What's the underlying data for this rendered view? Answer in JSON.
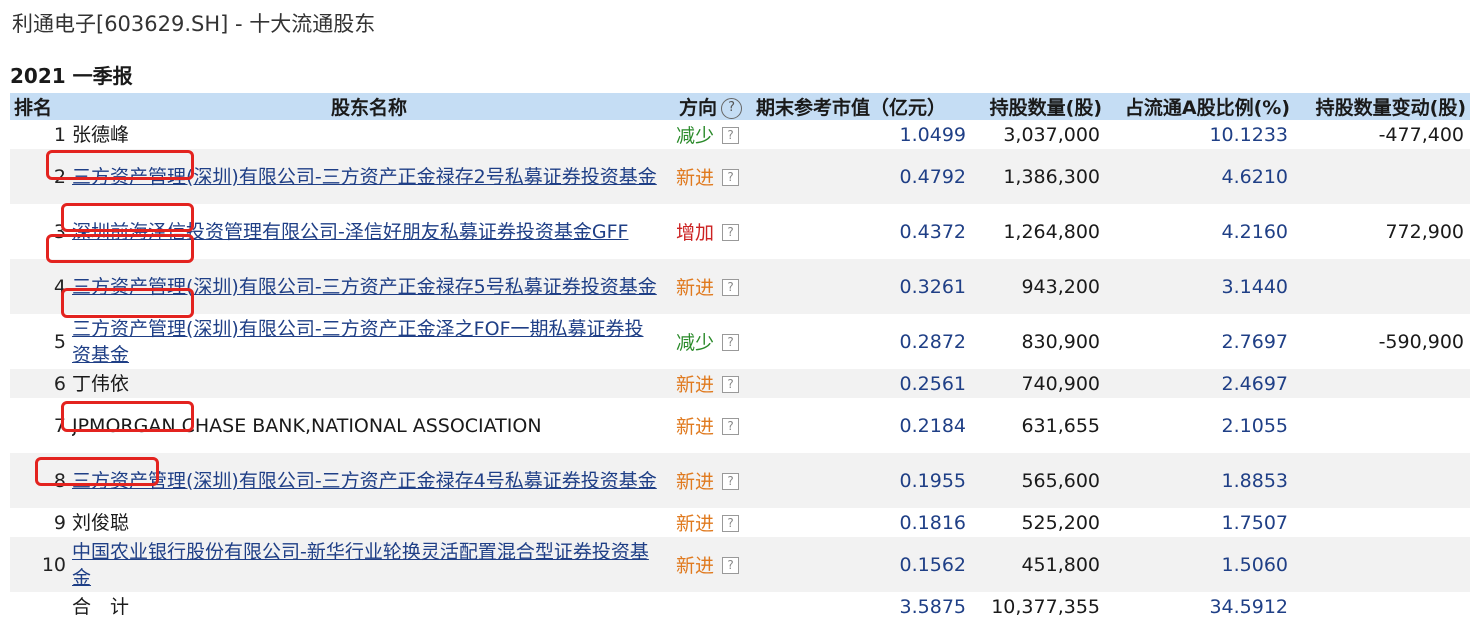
{
  "page": {
    "title": "利通电子[603629.SH] - 十大流通股东"
  },
  "report": {
    "period": "2021 一季报"
  },
  "table": {
    "headers": {
      "rank": "排名",
      "name": "股东名称",
      "direction": "方向",
      "help": "?",
      "market_value": "期末参考市值（亿元）",
      "shares": "持股数量(股)",
      "ratio": "占流通A股比例(%)",
      "change": "持股数量变动(股)"
    },
    "rows": [
      {
        "rank": "1",
        "name": "张德峰",
        "link": false,
        "direction": "减少",
        "dir_type": "down",
        "q": "?",
        "market_value": "1.0499",
        "shares": "3,037,000",
        "ratio": "10.1233",
        "change": "-477,400"
      },
      {
        "rank": "2",
        "name": "三方资产管理(深圳)有限公司-三方资产正金禄存2号私募证券投资基金",
        "link": true,
        "direction": "新进",
        "dir_type": "new",
        "q": "?",
        "market_value": "0.4792",
        "shares": "1,386,300",
        "ratio": "4.6210",
        "change": ""
      },
      {
        "rank": "3",
        "name": "深圳前海泽信投资管理有限公司-泽信好朋友私募证券投资基金GFF",
        "link": true,
        "direction": "增加",
        "dir_type": "up",
        "q": "?",
        "market_value": "0.4372",
        "shares": "1,264,800",
        "ratio": "4.2160",
        "change": "772,900"
      },
      {
        "rank": "4",
        "name": "三方资产管理(深圳)有限公司-三方资产正金禄存5号私募证券投资基金",
        "link": true,
        "direction": "新进",
        "dir_type": "new",
        "q": "?",
        "market_value": "0.3261",
        "shares": "943,200",
        "ratio": "3.1440",
        "change": ""
      },
      {
        "rank": "5",
        "name": "三方资产管理(深圳)有限公司-三方资产正金泽之FOF一期私募证券投资基金",
        "link": true,
        "direction": "减少",
        "dir_type": "down",
        "q": "?",
        "market_value": "0.2872",
        "shares": "830,900",
        "ratio": "2.7697",
        "change": "-590,900"
      },
      {
        "rank": "6",
        "name": "丁伟依",
        "link": false,
        "direction": "新进",
        "dir_type": "new",
        "q": "?",
        "market_value": "0.2561",
        "shares": "740,900",
        "ratio": "2.4697",
        "change": ""
      },
      {
        "rank": "7",
        "name": "JPMORGAN CHASE BANK,NATIONAL ASSOCIATION",
        "link": false,
        "direction": "新进",
        "dir_type": "new",
        "q": "?",
        "market_value": "0.2184",
        "shares": "631,655",
        "ratio": "2.1055",
        "change": ""
      },
      {
        "rank": "8",
        "name": "三方资产管理(深圳)有限公司-三方资产正金禄存4号私募证券投资基金",
        "link": true,
        "direction": "新进",
        "dir_type": "new",
        "q": "?",
        "market_value": "0.1955",
        "shares": "565,600",
        "ratio": "1.8853",
        "change": ""
      },
      {
        "rank": "9",
        "name": "刘俊聪",
        "link": false,
        "direction": "新进",
        "dir_type": "new",
        "q": "?",
        "market_value": "0.1816",
        "shares": "525,200",
        "ratio": "1.7507",
        "change": ""
      },
      {
        "rank": "10",
        "name": "中国农业银行股份有限公司-新华行业轮换灵活配置混合型证券投资基金",
        "link": true,
        "direction": "新进",
        "dir_type": "new",
        "q": "?",
        "market_value": "0.1562",
        "shares": "451,800",
        "ratio": "1.5060",
        "change": ""
      }
    ],
    "total": {
      "label": "合　计",
      "market_value": "3.5875",
      "shares": "10,377,355",
      "ratio": "34.5912"
    }
  },
  "colors": {
    "header_bg": "#c5ddf4",
    "alt_row_bg": "#f2f2f2",
    "link": "#1f3f86",
    "decrease": "#2a8a2a",
    "new": "#e07a1f",
    "increase": "#cc2222",
    "highlight_box": "#e3231f"
  },
  "icons": {
    "help": "question-circle-icon",
    "row_help": "question-box-icon"
  }
}
